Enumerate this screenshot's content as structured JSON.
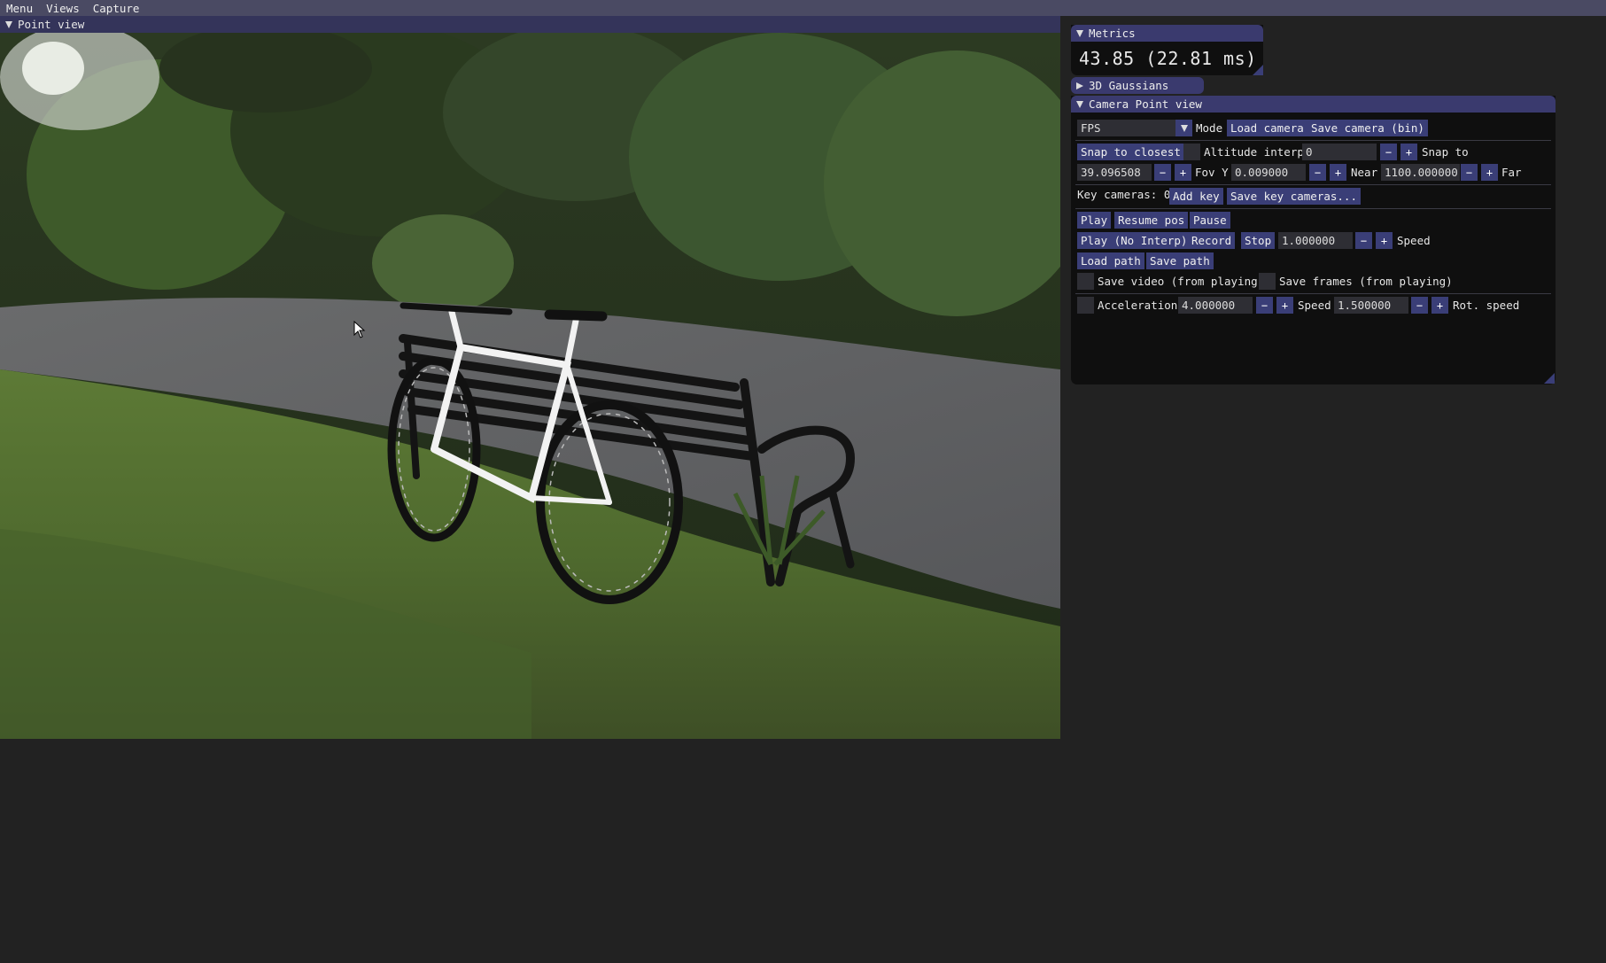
{
  "menubar": {
    "items": [
      "Menu",
      "Views",
      "Capture"
    ]
  },
  "point_view": {
    "title": "Point view",
    "scene": "rendered 3D Gaussian scene: white bicycle leaning on a black park bench, grass and gravel path"
  },
  "metrics": {
    "title": "Metrics",
    "fps_text": "43.85 (22.81 ms)"
  },
  "gaussians": {
    "title": "3D Gaussians"
  },
  "camera": {
    "title": "Camera Point view",
    "mode_value": "FPS",
    "mode_label": "Mode",
    "load_camera": "Load camera",
    "save_camera": "Save camera (bin)",
    "snap_to_closest": "Snap to closest",
    "altitude_interp_label": "Altitude interp",
    "altitude_value": "0",
    "snap_to_label": "Snap to",
    "fov_value": "39.096508",
    "fov_label": "Fov Y",
    "near_value": "0.009000",
    "near_label": "Near",
    "far_value": "1100.000000",
    "far_label": "Far",
    "key_cameras_label": "Key cameras: 0",
    "add_key": "Add key",
    "save_key_cameras": "Save key cameras...",
    "play": "Play",
    "resume_pos": "Resume pos",
    "pause": "Pause",
    "play_no_interp": "Play (No Interp)",
    "record": "Record",
    "stop": "Stop",
    "speed_value": "1.000000",
    "speed_label": "Speed",
    "load_path": "Load path",
    "save_path": "Save path",
    "save_video_label": "Save video (from playing)",
    "save_frames_label": "Save frames (from playing)",
    "acceleration_label": "Acceleration",
    "accel_value": "4.000000",
    "speed2_label": "Speed",
    "rot_value": "1.500000",
    "rot_label": "Rot. speed",
    "minus": "−",
    "plus": "+"
  }
}
